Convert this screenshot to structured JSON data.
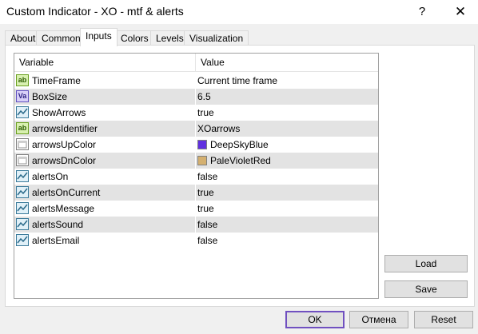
{
  "window": {
    "title": "Custom Indicator - XO - mtf & alerts",
    "help_glyph": "?",
    "close_glyph": "✕"
  },
  "tabs": [
    {
      "label": "About"
    },
    {
      "label": "Common"
    },
    {
      "label": "Inputs",
      "active": true
    },
    {
      "label": "Colors"
    },
    {
      "label": "Levels"
    },
    {
      "label": "Visualization"
    }
  ],
  "grid": {
    "headers": {
      "variable": "Variable",
      "value": "Value"
    },
    "rows": [
      {
        "icon": "string-type-icon",
        "icon_text": "ab",
        "name": "TimeFrame",
        "value": "Current time frame"
      },
      {
        "icon": "double-type-icon",
        "icon_text": "Va",
        "name": "BoxSize",
        "value": "6.5"
      },
      {
        "icon": "bool-type-icon",
        "name": "ShowArrows",
        "value": "true"
      },
      {
        "icon": "string-type-icon",
        "icon_text": "ab",
        "name": "arrowsIdentifier",
        "value": "XOarrows"
      },
      {
        "icon": "color-type-icon",
        "name": "arrowsUpColor",
        "value": "DeepSkyBlue",
        "swatch": "#6030e0"
      },
      {
        "icon": "color-type-icon",
        "name": "arrowsDnColor",
        "value": "PaleVioletRed",
        "swatch": "#d4b070"
      },
      {
        "icon": "bool-type-icon",
        "name": "alertsOn",
        "value": "false"
      },
      {
        "icon": "bool-type-icon",
        "name": "alertsOnCurrent",
        "value": "true"
      },
      {
        "icon": "bool-type-icon",
        "name": "alertsMessage",
        "value": "true"
      },
      {
        "icon": "bool-type-icon",
        "name": "alertsSound",
        "value": "false"
      },
      {
        "icon": "bool-type-icon",
        "name": "alertsEmail",
        "value": "false"
      }
    ]
  },
  "buttons": {
    "load": "Load",
    "save": "Save",
    "ok": "OK",
    "cancel": "Отмена",
    "reset": "Reset"
  }
}
